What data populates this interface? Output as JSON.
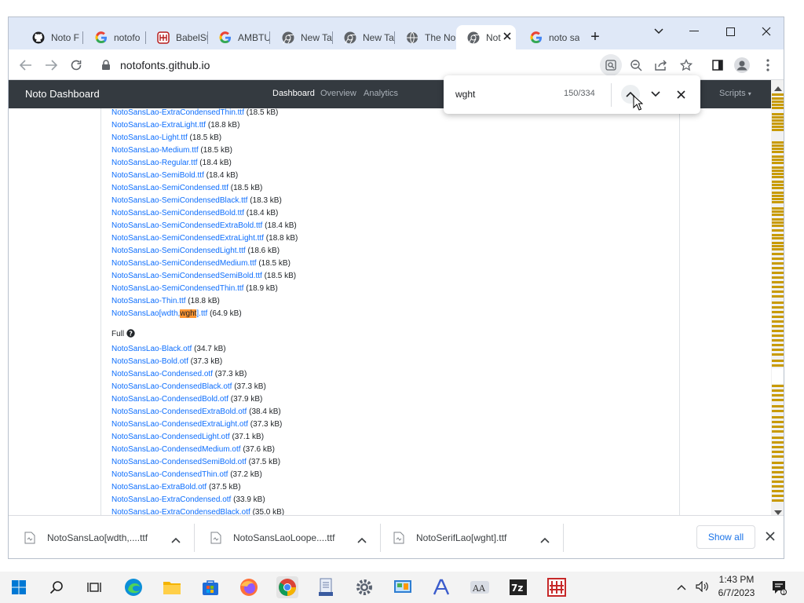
{
  "tabs": [
    {
      "label": "Noto F",
      "icon": "github-icon",
      "active": false
    },
    {
      "label": "notofo",
      "icon": "google-icon",
      "active": false
    },
    {
      "label": "BabelSt",
      "icon": "babelstone-icon",
      "active": false
    },
    {
      "label": "AMBTU",
      "icon": "google-icon",
      "active": false
    },
    {
      "label": "New Ta",
      "icon": "chrome-icon",
      "active": false
    },
    {
      "label": "New Ta",
      "icon": "chrome-icon",
      "active": false
    },
    {
      "label": "The No",
      "icon": "globe-icon",
      "active": false
    },
    {
      "label": "Not",
      "icon": "chrome-icon",
      "active": true
    },
    {
      "label": "noto sa",
      "icon": "google-icon",
      "active": false
    }
  ],
  "toolbar": {
    "url": "notofonts.github.io"
  },
  "site": {
    "brand": "Noto Dashboard",
    "nav": [
      "Dashboard",
      "Overview",
      "Analytics"
    ],
    "scripts": "Scripts"
  },
  "find": {
    "query": "wght",
    "count": "150/334"
  },
  "files_top": [
    {
      "name": "NotoSansLao-ExtraCondensedThin.ttf",
      "size": "(18.5 kB)"
    },
    {
      "name": "NotoSansLao-ExtraLight.ttf",
      "size": "(18.8 kB)"
    },
    {
      "name": "NotoSansLao-Light.ttf",
      "size": "(18.5 kB)"
    },
    {
      "name": "NotoSansLao-Medium.ttf",
      "size": "(18.5 kB)"
    },
    {
      "name": "NotoSansLao-Regular.ttf",
      "size": "(18.4 kB)"
    },
    {
      "name": "NotoSansLao-SemiBold.ttf",
      "size": "(18.4 kB)"
    },
    {
      "name": "NotoSansLao-SemiCondensed.ttf",
      "size": "(18.5 kB)"
    },
    {
      "name": "NotoSansLao-SemiCondensedBlack.ttf",
      "size": "(18.3 kB)"
    },
    {
      "name": "NotoSansLao-SemiCondensedBold.ttf",
      "size": "(18.4 kB)"
    },
    {
      "name": "NotoSansLao-SemiCondensedExtraBold.ttf",
      "size": "(18.4 kB)"
    },
    {
      "name": "NotoSansLao-SemiCondensedExtraLight.ttf",
      "size": "(18.8 kB)"
    },
    {
      "name": "NotoSansLao-SemiCondensedLight.ttf",
      "size": "(18.6 kB)"
    },
    {
      "name": "NotoSansLao-SemiCondensedMedium.ttf",
      "size": "(18.5 kB)"
    },
    {
      "name": "NotoSansLao-SemiCondensedSemiBold.ttf",
      "size": "(18.5 kB)"
    },
    {
      "name": "NotoSansLao-SemiCondensedThin.ttf",
      "size": "(18.9 kB)"
    },
    {
      "name": "NotoSansLao-Thin.ttf",
      "size": "(18.8 kB)"
    }
  ],
  "variable_file": {
    "pre": "NotoSansLao[wdth,",
    "match": "wght",
    "post": "].ttf",
    "size": "(64.9 kB)"
  },
  "full_header": "Full",
  "files_full": [
    {
      "name": "NotoSansLao-Black.otf",
      "size": "(34.7 kB)"
    },
    {
      "name": "NotoSansLao-Bold.otf",
      "size": "(37.3 kB)"
    },
    {
      "name": "NotoSansLao-Condensed.otf",
      "size": "(37.3 kB)"
    },
    {
      "name": "NotoSansLao-CondensedBlack.otf",
      "size": "(37.3 kB)"
    },
    {
      "name": "NotoSansLao-CondensedBold.otf",
      "size": "(37.9 kB)"
    },
    {
      "name": "NotoSansLao-CondensedExtraBold.otf",
      "size": "(38.4 kB)"
    },
    {
      "name": "NotoSansLao-CondensedExtraLight.otf",
      "size": "(37.3 kB)"
    },
    {
      "name": "NotoSansLao-CondensedLight.otf",
      "size": "(37.1 kB)"
    },
    {
      "name": "NotoSansLao-CondensedMedium.otf",
      "size": "(37.6 kB)"
    },
    {
      "name": "NotoSansLao-CondensedSemiBold.otf",
      "size": "(37.5 kB)"
    },
    {
      "name": "NotoSansLao-CondensedThin.otf",
      "size": "(37.2 kB)"
    },
    {
      "name": "NotoSansLao-ExtraBold.otf",
      "size": "(37.5 kB)"
    },
    {
      "name": "NotoSansLao-ExtraCondensed.otf",
      "size": "(33.9 kB)"
    },
    {
      "name": "NotoSansLao-ExtraCondensedBlack.otf",
      "size": "(35.0 kB)"
    }
  ],
  "downloads": [
    {
      "name": "NotoSansLao[wdth,....ttf"
    },
    {
      "name": "NotoSansLaoLoope....ttf"
    },
    {
      "name": "NotoSerifLao[wght].ttf"
    }
  ],
  "shelf": {
    "show_all": "Show all"
  },
  "taskbar": {
    "time": "1:43 PM",
    "date": "6/7/2023"
  },
  "colors": {
    "link": "#0d6efd",
    "navbar": "#343a40",
    "highlight": "#ff9632",
    "scroll_marker": "#c89a00"
  }
}
